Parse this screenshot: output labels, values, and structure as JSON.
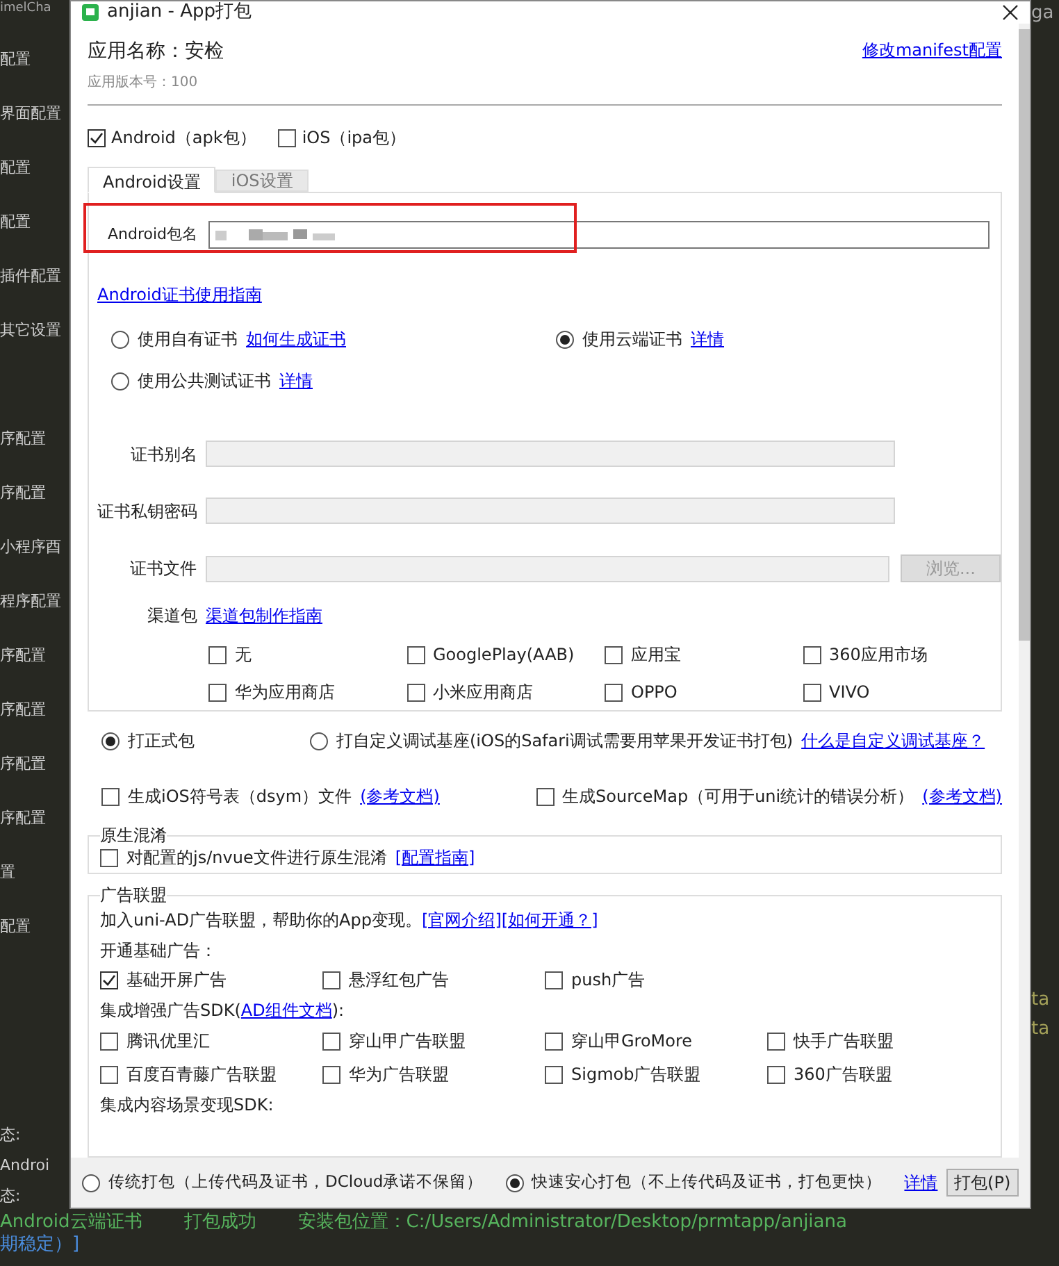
{
  "background": {
    "top_fragment": "imelCha",
    "top_right_fragment": "ga",
    "sidebar_items": [
      "配置",
      "界面配置",
      "配置",
      "配置",
      "插件配置",
      "其它设置",
      "序配置",
      "序配置",
      "小程序酉",
      "程序配置",
      "序配置",
      "序配置",
      "序配置",
      "序配置",
      "置",
      "配置"
    ],
    "right_fragments": [
      "ta",
      "ta"
    ],
    "status_lines": [
      "态:",
      "Androi",
      "态:"
    ],
    "console_segments": [
      "Android云端证书",
      "打包成功",
      "安装包位置：C:/Users/Administrator/Desktop/prmtapp/anjiana"
    ],
    "console_tail": "期稳定）]"
  },
  "dialog": {
    "title": "anjian - App打包",
    "app_name": "应用名称：安检",
    "version": "应用版本号：100",
    "manifest_link": "修改manifest配置",
    "platforms": [
      {
        "label": "Android（apk包）",
        "checked": true
      },
      {
        "label": "iOS（ipa包）",
        "checked": false
      }
    ],
    "tabs": [
      {
        "label": "Android设置",
        "selected": true
      },
      {
        "label": "iOS设置",
        "selected": false
      }
    ],
    "package_name": {
      "label": "Android包名"
    },
    "cert_guide_link": "Android证书使用指南",
    "cert_options": [
      {
        "label": "使用自有证书",
        "link": "如何生成证书",
        "selected": false
      },
      {
        "label": "使用云端证书",
        "link": "详情",
        "selected": true
      },
      {
        "label": "使用公共测试证书",
        "link": "详情",
        "selected": false
      }
    ],
    "cert_fields": [
      {
        "label": "证书别名"
      },
      {
        "label": "证书私钥密码"
      },
      {
        "label": "证书文件",
        "button": "浏览..."
      }
    ],
    "channels": {
      "label": "渠道包",
      "link": "渠道包制作指南",
      "items": [
        {
          "label": "无",
          "checked": false
        },
        {
          "label": "GooglePlay(AAB)",
          "checked": false
        },
        {
          "label": "应用宝",
          "checked": false
        },
        {
          "label": "360应用市场",
          "checked": false
        },
        {
          "label": "华为应用商店",
          "checked": false
        },
        {
          "label": "小米应用商店",
          "checked": false
        },
        {
          "label": "OPPO",
          "checked": false
        },
        {
          "label": "VIVO",
          "checked": false
        }
      ]
    },
    "build_types": [
      {
        "label": "打正式包",
        "selected": true
      },
      {
        "label": "打自定义调试基座(iOS的Safari调试需要用苹果开发证书打包)",
        "link": "什么是自定义调试基座？",
        "selected": false
      }
    ],
    "options": [
      {
        "label": "生成iOS符号表（dsym）文件",
        "link": "(参考文档)",
        "checked": false
      },
      {
        "label": "生成SourceMap（可用于uni统计的错误分析）",
        "link": "(参考文档)",
        "checked": false
      }
    ],
    "obfuscation": {
      "title": "原生混淆",
      "label": "对配置的js/nvue文件进行原生混淆",
      "link": "[配置指南]",
      "checked": false
    },
    "ads": {
      "title": "广告联盟",
      "intro": "加入uni-AD广告联盟，帮助你的App变现。",
      "links": [
        "[官网介绍]",
        "[如何开通？]"
      ],
      "basic_title": "开通基础广告：",
      "basic": [
        {
          "label": "基础开屏广告",
          "checked": true
        },
        {
          "label": "悬浮红包广告",
          "checked": false
        },
        {
          "label": "push广告",
          "checked": false
        }
      ],
      "enhanced_prefix": "集成增强广告SDK(",
      "enhanced_link": "AD组件文档",
      "enhanced_suffix": "):",
      "enhanced": [
        {
          "label": "腾讯优里汇",
          "checked": false
        },
        {
          "label": "穿山甲广告联盟",
          "checked": false
        },
        {
          "label": "穿山甲GroMore",
          "checked": false
        },
        {
          "label": "快手广告联盟",
          "checked": false
        },
        {
          "label": "百度百青藤广告联盟",
          "checked": false
        },
        {
          "label": "华为广告联盟",
          "checked": false
        },
        {
          "label": "Sigmob广告联盟",
          "checked": false
        },
        {
          "label": "360广告联盟",
          "checked": false
        }
      ],
      "content_title": "集成内容场景变现SDK:"
    },
    "pack_modes": [
      {
        "label": "传统打包（上传代码及证书，DCloud承诺不保留）",
        "selected": false
      },
      {
        "label": "快速安心打包（不上传代码及证书，打包更快）",
        "selected": true
      }
    ],
    "detail_link": "详情",
    "pack_button": "打包(P)"
  }
}
